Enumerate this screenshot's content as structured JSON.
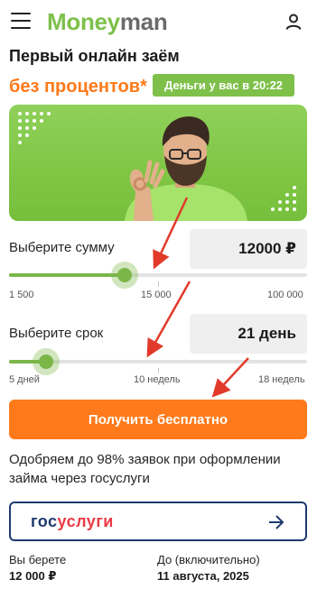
{
  "colors": {
    "brand_green": "#7ec04a",
    "orange": "#ff7a1a",
    "badge_green": "#7ec04a",
    "track_green": "#7ab648",
    "gos_blue": "#1e3a6e",
    "gos_red": "#ea3a44",
    "annotation_red": "#e23a2a"
  },
  "header": {
    "menu_icon": "hamburger-menu-icon",
    "logo_part1": "Money",
    "logo_part2": "man",
    "user_icon": "user-profile-icon"
  },
  "hero": {
    "headline": "Первый онлайн заём",
    "subline": "без процентов*",
    "badge": "Деньги у вас в 20:22"
  },
  "amount": {
    "label": "Выберите сумму",
    "value": "12000 ₽",
    "min_label": "1 500",
    "mid_label": "15 000",
    "max_label": "100 000",
    "min": 1500,
    "max": 100000,
    "current": 12000
  },
  "term": {
    "label": "Выберите срок",
    "value": "21 день",
    "min_label": "5 дней",
    "mid_label": "10 недель",
    "max_label": "18 недель",
    "min_days": 5,
    "max_days": 126,
    "current_days": 21
  },
  "cta": {
    "label": "Получить бесплатно"
  },
  "approve_text": "Одобряем до 98% заявок при оформлении займа через госуслуги",
  "gosuslugi": {
    "part1": "гос",
    "part2": "услуги",
    "arrow_icon": "arrow-right-icon"
  },
  "summary": {
    "take_label": "Вы берете",
    "take_value": "12 000 ₽",
    "until_label": "До (включительно)",
    "until_value": "11 августа, 2025"
  }
}
